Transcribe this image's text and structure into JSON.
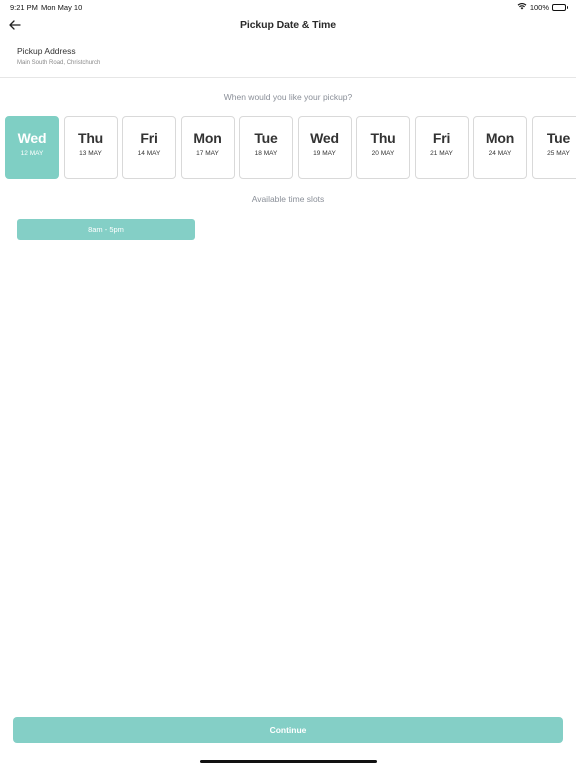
{
  "status_bar": {
    "time": "9:21 PM",
    "date": "Mon May 10",
    "battery": "100%",
    "icons": [
      "wifi-icon",
      "battery-icon"
    ]
  },
  "header": {
    "title": "Pickup Date & Time",
    "back_icon": "arrow-left-icon"
  },
  "address": {
    "label": "Pickup Address",
    "value": "Main South Road, Christchurch"
  },
  "date_picker": {
    "question": "When would you like your pickup?",
    "selected_index": 0,
    "dates": [
      {
        "day": "Wed",
        "date": "12 MAY"
      },
      {
        "day": "Thu",
        "date": "13 MAY"
      },
      {
        "day": "Fri",
        "date": "14 MAY"
      },
      {
        "day": "Mon",
        "date": "17 MAY"
      },
      {
        "day": "Tue",
        "date": "18 MAY"
      },
      {
        "day": "Wed",
        "date": "19 MAY"
      },
      {
        "day": "Thu",
        "date": "20 MAY"
      },
      {
        "day": "Fri",
        "date": "21 MAY"
      },
      {
        "day": "Mon",
        "date": "24 MAY"
      },
      {
        "day": "Tue",
        "date": "25 MAY"
      }
    ]
  },
  "time_slots": {
    "heading": "Available time slots",
    "slots": [
      "8am - 5pm"
    ]
  },
  "footer": {
    "continue_label": "Continue"
  },
  "colors": {
    "accent": "#84cfc6",
    "text": "#2b2b2b",
    "muted": "#8a8f98"
  }
}
